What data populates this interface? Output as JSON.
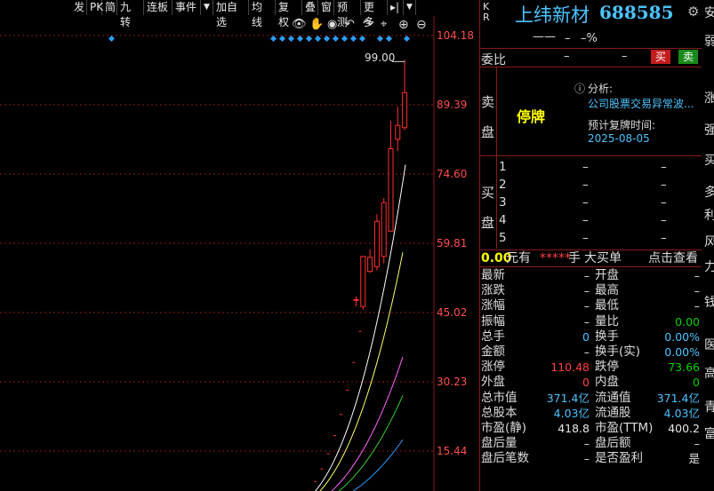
{
  "toolbar": {
    "items": [
      "发",
      "PK",
      "简",
      "九转",
      "连板",
      "事件",
      "加自选",
      "均线",
      "复权",
      "叠",
      "窗",
      "预测",
      "更多"
    ],
    "dropdown_glyph": "▼",
    "overflow_glyph": "▸|"
  },
  "chart": {
    "max_label": "99.00",
    "price_ticks": [
      "104.18",
      "89.39",
      "74.60",
      "59.81",
      "45.02",
      "30.23",
      "15.44"
    ],
    "colors": {
      "up": "#ff3030",
      "grid": "#8b1a1a",
      "marker": "#2a9df4"
    },
    "candles": [
      {
        "o": 47.8,
        "h": 48.5,
        "l": 46.3,
        "c": 47.6
      },
      {
        "o": 46.3,
        "h": 57.0,
        "l": 45.6,
        "c": 57.0
      },
      {
        "o": 53.8,
        "h": 58.5,
        "l": 53.5,
        "c": 56.8
      },
      {
        "o": 54.8,
        "h": 66.0,
        "l": 54.0,
        "c": 64.5
      },
      {
        "o": 57.0,
        "h": 69.5,
        "l": 55.5,
        "c": 68.5
      },
      {
        "o": 62.4,
        "h": 86.0,
        "l": 62.4,
        "c": 80.0
      },
      {
        "o": 82.0,
        "h": 89.0,
        "l": 79.5,
        "c": 85.0
      },
      {
        "o": 84.5,
        "h": 99.0,
        "l": 84.0,
        "c": 92.0
      }
    ]
  },
  "header": {
    "code_badge": [
      "K",
      "R"
    ],
    "name": "上纬新材",
    "code": "688585",
    "price": "——",
    "change": "–",
    "pct": "–%",
    "gear_icon": "gear-icon"
  },
  "weibi": {
    "label": "委比",
    "v1": "–",
    "v2": "–",
    "buy": "买",
    "sell": "卖"
  },
  "sell_side": {
    "label_top": "卖",
    "label_bottom": "盘",
    "status": "停牌",
    "analysis_label": "分析:",
    "analysis_text": "公司股票交易异常波...",
    "resume_label": "预计复牌时间:",
    "resume_date": "2025-08-05"
  },
  "buy_side": {
    "label_top": "买",
    "label_bottom": "盘",
    "levels": [
      {
        "n": "1",
        "p": "–",
        "v": "–"
      },
      {
        "n": "2",
        "p": "–",
        "v": "–"
      },
      {
        "n": "3",
        "p": "–",
        "v": "–"
      },
      {
        "n": "4",
        "p": "–",
        "v": "–"
      },
      {
        "n": "5",
        "p": "–",
        "v": "–"
      }
    ]
  },
  "bigorder": {
    "amount": "0.00",
    "unit": "元有",
    "mask": "*****",
    "shou": "手",
    "label": "大买单",
    "link": "点击查看"
  },
  "stats": [
    {
      "l1": "最新",
      "v1": "–",
      "l2": "开盘",
      "v2": "–",
      "c1": "white",
      "c2": "white"
    },
    {
      "l1": "涨跌",
      "v1": "–",
      "l2": "最高",
      "v2": "–",
      "c1": "white",
      "c2": "white"
    },
    {
      "l1": "涨幅",
      "v1": "–",
      "l2": "最低",
      "v2": "–",
      "c1": "white",
      "c2": "white"
    },
    {
      "l1": "振幅",
      "v1": "–",
      "l2": "量比",
      "v2": "0.00",
      "c1": "white",
      "c2": "green"
    },
    {
      "l1": "总手",
      "v1": "0",
      "l2": "换手",
      "v2": "0.00%",
      "c1": "cyan",
      "c2": "cyan"
    },
    {
      "l1": "金额",
      "v1": "–",
      "l2": "换手(实)",
      "v2": "0.00%",
      "c1": "white",
      "c2": "cyan"
    },
    {
      "l1": "涨停",
      "v1": "110.48",
      "l2": "跌停",
      "v2": "73.66",
      "c1": "red",
      "c2": "green"
    },
    {
      "l1": "外盘",
      "v1": "0",
      "l2": "内盘",
      "v2": "0",
      "c1": "red",
      "c2": "green"
    },
    {
      "l1": "总市值",
      "v1": "371.4亿",
      "l2": "流通值",
      "v2": "371.4亿",
      "c1": "cyan",
      "c2": "cyan"
    },
    {
      "l1": "总股本",
      "v1": "4.03亿",
      "l2": "流通股",
      "v2": "4.03亿",
      "c1": "cyan",
      "c2": "cyan"
    },
    {
      "l1": "市盈(静)",
      "v1": "418.8",
      "l2": "市盈(TTM)",
      "v2": "400.2",
      "c1": "white",
      "c2": "white"
    },
    {
      "l1": "盘后量",
      "v1": "–",
      "l2": "盘后额",
      "v2": "–",
      "c1": "white",
      "c2": "white"
    },
    {
      "l1": "盘后笔数",
      "v1": "–",
      "l2": "是否盈利",
      "v2": "是",
      "c1": "white",
      "c2": "white"
    }
  ],
  "edge_glyphs": [
    "安",
    "弱",
    "涨",
    "强",
    "买",
    "多",
    "利",
    "风",
    "力",
    "钱",
    "医",
    "高",
    "青",
    "富"
  ]
}
